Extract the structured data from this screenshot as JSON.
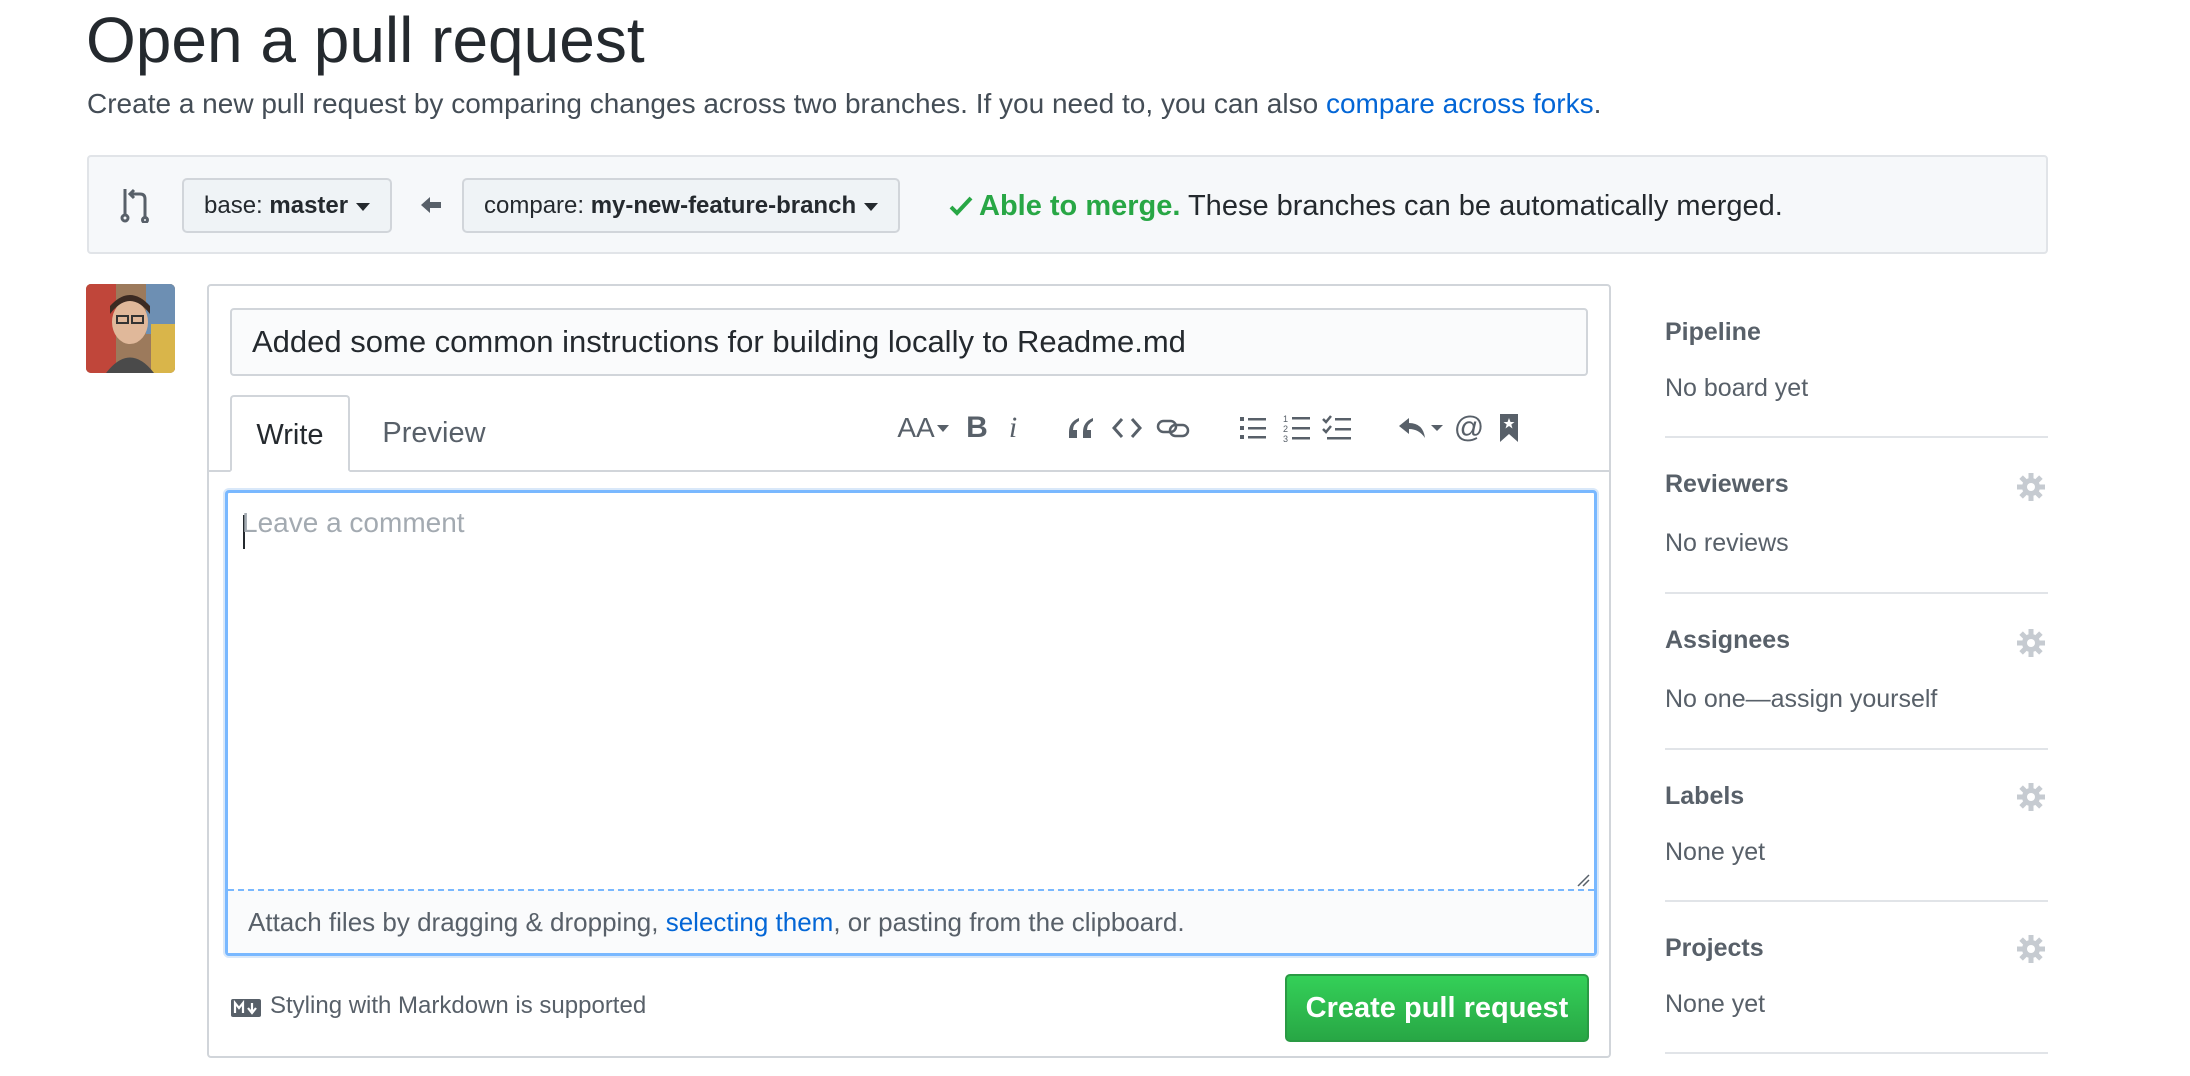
{
  "header": {
    "title": "Open a pull request",
    "subtitle_prefix": "Create a new pull request by comparing changes across two branches. If you need to, you can also ",
    "subtitle_link": "compare across forks",
    "subtitle_suffix": "."
  },
  "range": {
    "base_key": "base:",
    "base_value": "master",
    "compare_key": "compare:",
    "compare_value": "my-new-feature-branch",
    "merge_ok": "Able to merge.",
    "merge_text": " These branches can be automatically merged."
  },
  "form": {
    "title_value": "Added some common instructions for building locally to Readme.md",
    "tabs": [
      "Write",
      "Preview"
    ],
    "comment_placeholder": "Leave a comment",
    "attach_prefix": "Attach files by dragging & dropping, ",
    "attach_link": "selecting them",
    "attach_suffix": ", or pasting from the clipboard.",
    "markdown_note": "Styling with Markdown is supported",
    "create_button": "Create pull request",
    "toolbar_icons": [
      "text-size-icon",
      "bold-icon",
      "italic-icon",
      "quote-icon",
      "code-icon",
      "link-icon",
      "bulleted-list-icon",
      "numbered-list-icon",
      "task-list-icon",
      "reply-icon",
      "mention-icon",
      "bookmark-icon"
    ],
    "toolbar_labels": {
      "text_size": "AA",
      "bold": "B",
      "italic": "i",
      "mention": "@"
    }
  },
  "sidebar": {
    "sections": [
      {
        "heading": "Pipeline",
        "value": "No board yet",
        "gear": false
      },
      {
        "heading": "Reviewers",
        "value": "No reviews",
        "gear": true
      },
      {
        "heading": "Assignees",
        "value": "No one—assign yourself",
        "gear": true
      },
      {
        "heading": "Labels",
        "value": "None yet",
        "gear": true
      },
      {
        "heading": "Projects",
        "value": "None yet",
        "gear": true
      }
    ]
  },
  "colors": {
    "accent_blue": "#0366d6",
    "success_green": "#28a745",
    "focus_border": "#79b8ff"
  }
}
